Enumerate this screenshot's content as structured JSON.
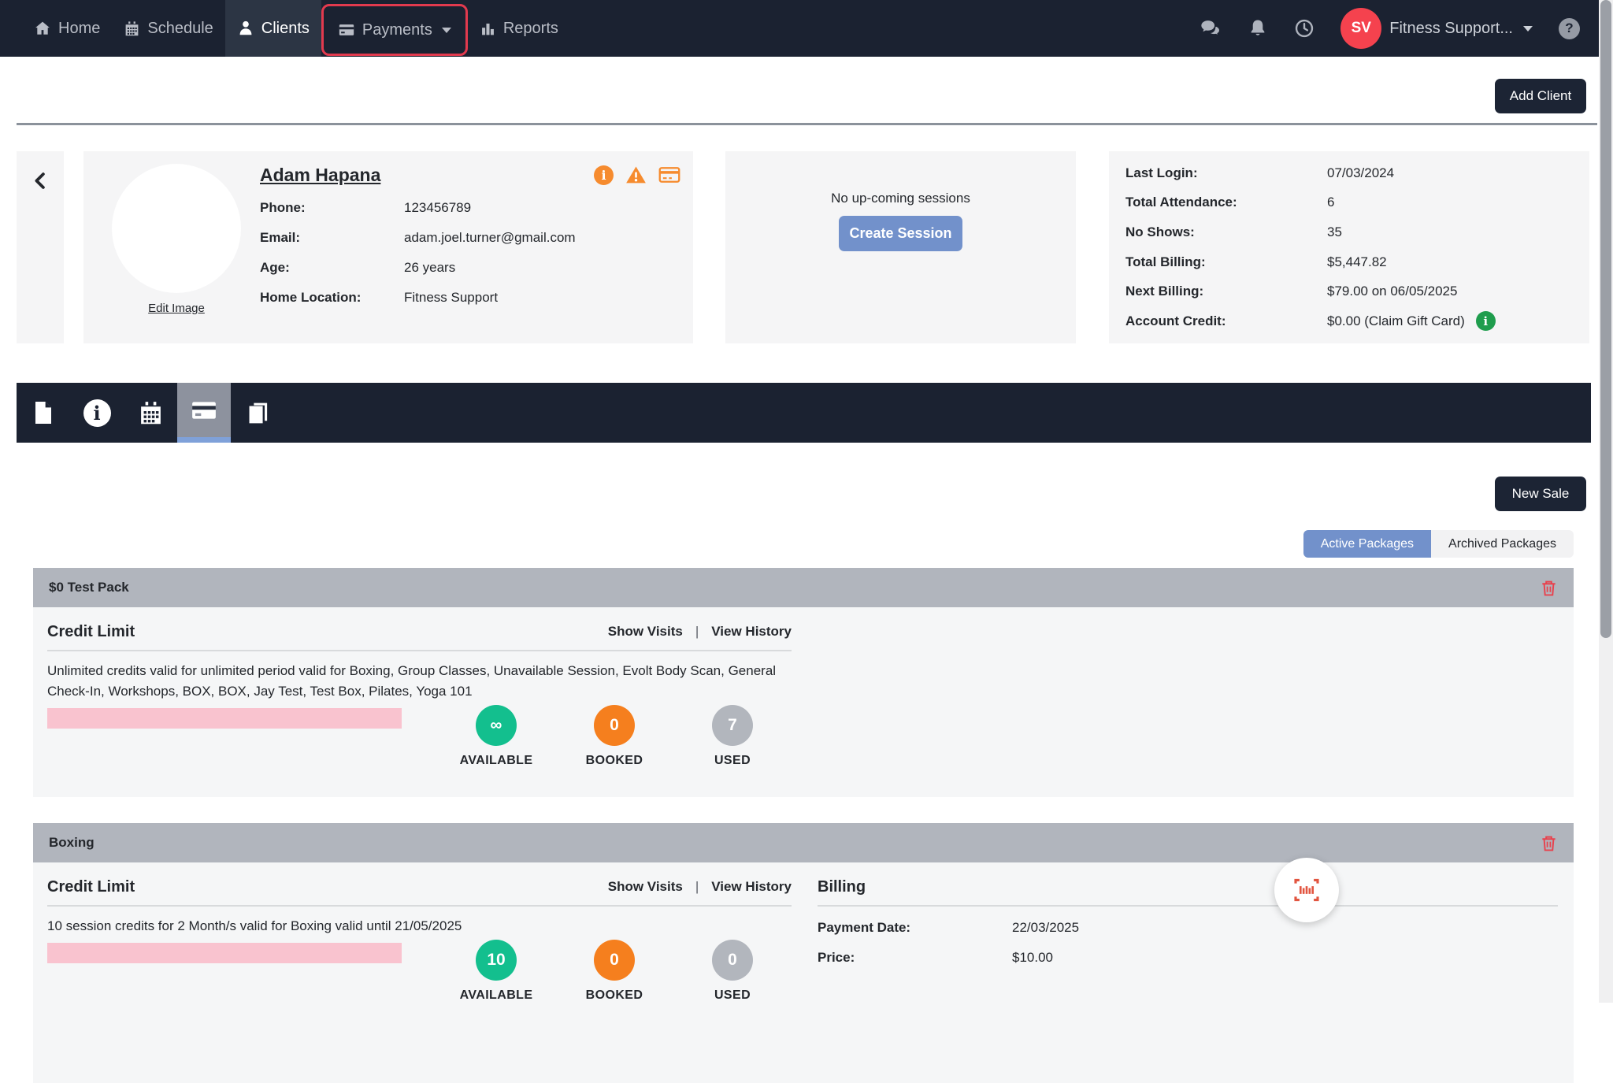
{
  "colors": {
    "navy": "#1b2231",
    "nav_active_bg": "#2c3544",
    "highlight_red": "#e23a4e",
    "avatar_red": "#f5424e",
    "primary_blue": "#7291cb",
    "tab_underline_blue": "#7fa1d9",
    "badge_green": "#13bf8e",
    "badge_orange": "#f57f1e",
    "badge_gray": "#b2b6bd",
    "progress_pink": "#f9c3cf",
    "alert_orange": "#f68b2e",
    "info_green": "#1f9d4d",
    "trash_red": "#e8414d",
    "barcode_red": "#e25540",
    "package_header_gray": "#b1b5bd"
  },
  "navbar": {
    "items": [
      {
        "label": "Home"
      },
      {
        "label": "Schedule"
      },
      {
        "label": "Clients",
        "active": true
      },
      {
        "label": "Payments",
        "highlighted": true
      },
      {
        "label": "Reports"
      }
    ],
    "account": {
      "initials": "SV",
      "name": "Fitness Support..."
    },
    "help_glyph": "?"
  },
  "header": {
    "add_client_label": "Add Client"
  },
  "client": {
    "name": "Adam Hapana",
    "edit_image_label": "Edit Image",
    "alert_info_glyph": "i",
    "details": [
      {
        "label": "Phone:",
        "value": "123456789"
      },
      {
        "label": "Email:",
        "value": "adam.joel.turner@gmail.com"
      },
      {
        "label": "Age:",
        "value": "26 years"
      },
      {
        "label": "Home Location:",
        "value": "Fitness Support"
      }
    ]
  },
  "sessions": {
    "empty_text": "No up-coming sessions",
    "create_label": "Create Session"
  },
  "stats": [
    {
      "label": "Last Login:",
      "value": "07/03/2024"
    },
    {
      "label": "Total Attendance:",
      "value": "6"
    },
    {
      "label": "No Shows:",
      "value": "35"
    },
    {
      "label": "Total Billing:",
      "value": "$5,447.82"
    },
    {
      "label": "Next Billing:",
      "value": "$79.00 on 06/05/2025"
    },
    {
      "label": "Account Credit:",
      "value": "$0.00 (Claim Gift Card)",
      "info_glyph": "i"
    }
  ],
  "content": {
    "new_sale_label": "New Sale",
    "toggle": {
      "active_label": "Active Packages",
      "archived_label": "Archived Packages"
    },
    "packages": [
      {
        "title": "$0 Test Pack",
        "section_title": "Credit Limit",
        "show_visits": "Show Visits",
        "separator": "|",
        "view_history": "View History",
        "description": "Unlimited credits valid for unlimited period valid for Boxing, Group Classes, Unavailable Session, Evolt Body Scan, General Check-In, Workshops, BOX, BOX, Jay Test, Test Box, Pilates, Yoga 101",
        "badges": [
          {
            "value": "∞",
            "label": "AVAILABLE",
            "color": "#13bf8e"
          },
          {
            "value": "0",
            "label": "BOOKED",
            "color": "#f57f1e"
          },
          {
            "value": "7",
            "label": "USED",
            "color": "#b2b6bd"
          }
        ]
      },
      {
        "title": "Boxing",
        "section_title": "Credit Limit",
        "show_visits": "Show Visits",
        "separator": "|",
        "view_history": "View History",
        "description": "10 session credits for 2 Month/s valid for Boxing valid until 21/05/2025",
        "badges": [
          {
            "value": "10",
            "label": "AVAILABLE",
            "color": "#13bf8e"
          },
          {
            "value": "0",
            "label": "BOOKED",
            "color": "#f57f1e"
          },
          {
            "value": "0",
            "label": "USED",
            "color": "#b2b6bd"
          }
        ],
        "billing": {
          "title": "Billing",
          "rows": [
            {
              "label": "Payment Date:",
              "value": "22/03/2025"
            },
            {
              "label": "Price:",
              "value": "$10.00"
            }
          ]
        }
      }
    ]
  }
}
